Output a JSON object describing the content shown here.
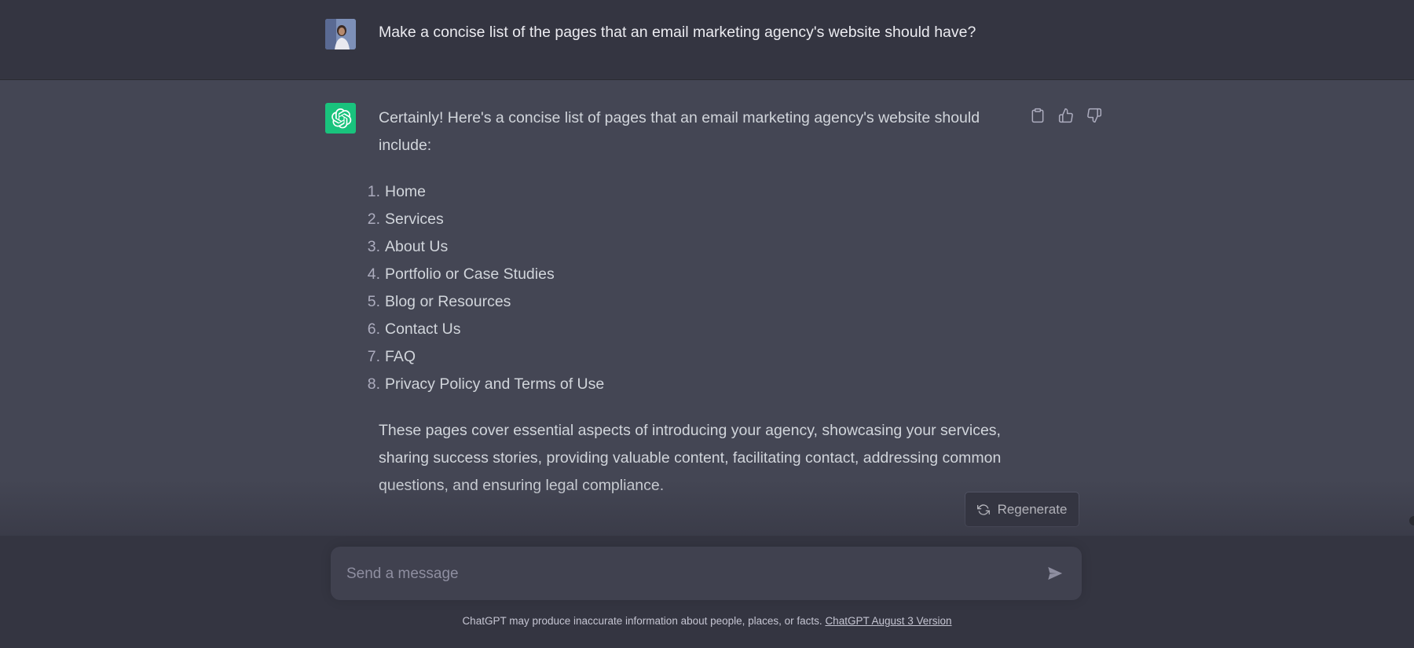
{
  "user_message": {
    "text": "Make a concise list of the pages that an email marketing agency's website should have?"
  },
  "assistant_message": {
    "intro": "Certainly! Here's a concise list of pages that an email marketing agency's website should include:",
    "list": [
      {
        "num": "1.",
        "text": "Home"
      },
      {
        "num": "2.",
        "text": "Services"
      },
      {
        "num": "3.",
        "text": "About Us"
      },
      {
        "num": "4.",
        "text": "Portfolio or Case Studies"
      },
      {
        "num": "5.",
        "text": "Blog or Resources"
      },
      {
        "num": "6.",
        "text": "Contact Us"
      },
      {
        "num": "7.",
        "text": "FAQ"
      },
      {
        "num": "8.",
        "text": "Privacy Policy and Terms of Use"
      }
    ],
    "outro": "These pages cover essential aspects of introducing your agency, showcasing your services, sharing success stories, providing valuable content, facilitating contact, addressing common questions, and ensuring legal compliance."
  },
  "actions": {
    "copy_icon": "clipboard-icon",
    "like_icon": "thumbs-up-icon",
    "dislike_icon": "thumbs-down-icon"
  },
  "regenerate": {
    "label": "Regenerate",
    "icon": "refresh-icon"
  },
  "composer": {
    "placeholder": "Send a message",
    "value": "",
    "send_icon": "send-icon"
  },
  "footer": {
    "disclaimer": "ChatGPT may produce inaccurate information about people, places, or facts. ",
    "version_link": "ChatGPT August 3 Version"
  },
  "colors": {
    "user_bg": "#343541",
    "assistant_bg": "#444654",
    "gpt_brand": "#19c37d",
    "composer_bg": "#40414f"
  }
}
